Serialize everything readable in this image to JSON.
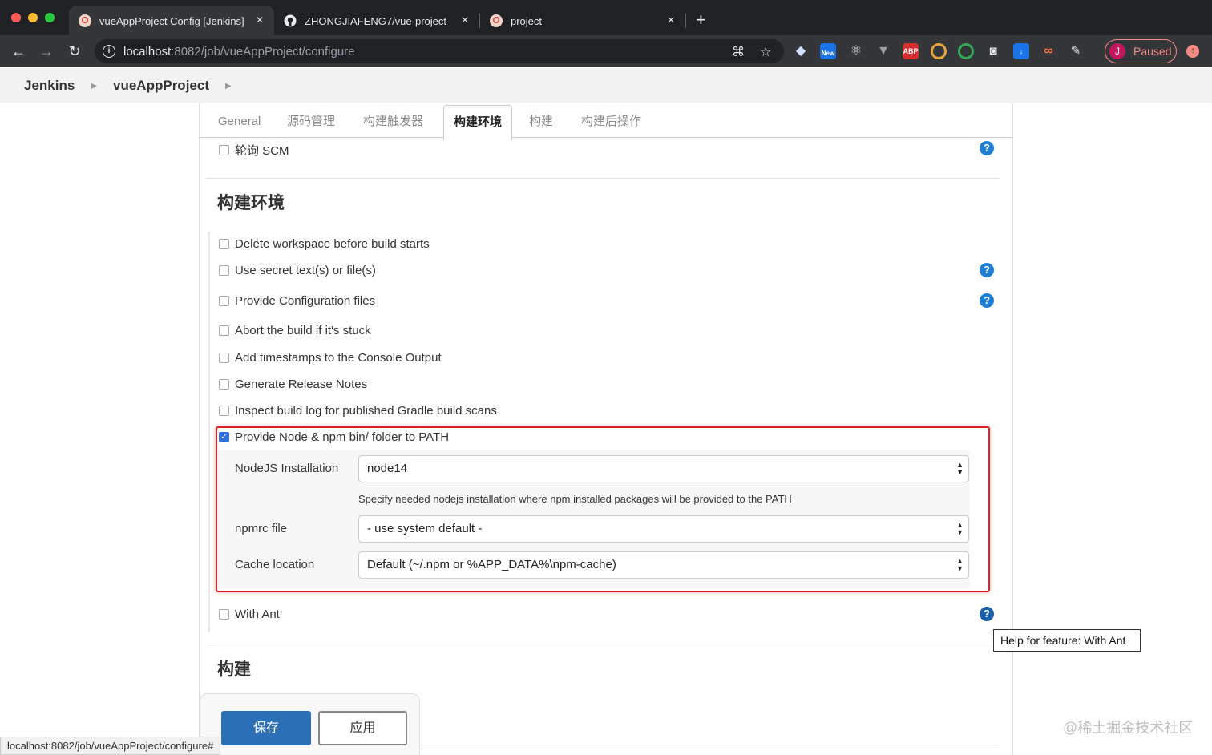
{
  "browser": {
    "tabs": [
      {
        "title": "vueAppProject Config [Jenkins]",
        "icon": "jenkins-icon",
        "active": true
      },
      {
        "title": "ZHONGJIAFENG7/vue-project",
        "icon": "github-icon",
        "active": false
      },
      {
        "title": "project",
        "icon": "jenkins-icon",
        "active": false
      }
    ],
    "new_tab": "+",
    "url_host": "localhost",
    "url_path": ":8082/job/vueAppProject/configure",
    "profile_initial": "J",
    "profile_status": "Paused",
    "extension_new_badge": "New",
    "extension_abp": "ABP"
  },
  "breadcrumb": [
    "Jenkins",
    "vueAppProject"
  ],
  "config_tabs": [
    "General",
    "源码管理",
    "构建触发器",
    "构建环境",
    "构建",
    "构建后操作"
  ],
  "active_tab_index": 3,
  "poll_scm_label": "轮询 SCM",
  "build_env": {
    "title": "构建环境",
    "options": [
      {
        "label": "Delete workspace before build starts",
        "checked": false,
        "help": false
      },
      {
        "label": "Use secret text(s) or file(s)",
        "checked": false,
        "help": true
      },
      {
        "label": "Provide Configuration files",
        "checked": false,
        "help": true
      },
      {
        "label": "Abort the build if it's stuck",
        "checked": false,
        "help": false
      },
      {
        "label": "Add timestamps to the Console Output",
        "checked": false,
        "help": false
      },
      {
        "label": "Generate Release Notes",
        "checked": false,
        "help": false
      },
      {
        "label": "Inspect build log for published Gradle build scans",
        "checked": false,
        "help": false
      },
      {
        "label": "Provide Node & npm bin/ folder to PATH",
        "checked": true,
        "help": false
      }
    ],
    "node": {
      "installation_label": "NodeJS Installation",
      "installation_value": "node14",
      "installation_desc": "Specify needed nodejs installation where npm installed packages will be provided to the PATH",
      "npmrc_label": "npmrc file",
      "npmrc_value": "- use system default -",
      "cache_label": "Cache location",
      "cache_value": "Default (~/.npm or %APP_DATA%\\npm-cache)"
    },
    "with_ant_label": "With Ant"
  },
  "build_section_title": "构建",
  "tooltip": "Help for feature: With Ant",
  "buttons": {
    "save": "保存",
    "apply": "应用"
  },
  "status_url": "localhost:8082/job/vueAppProject/configure#",
  "watermark": "@稀土掘金技术社区",
  "colors": {
    "highlight": "#e02020",
    "save_button": "#2b6fb6",
    "help_icon": "#1f7fd4"
  }
}
